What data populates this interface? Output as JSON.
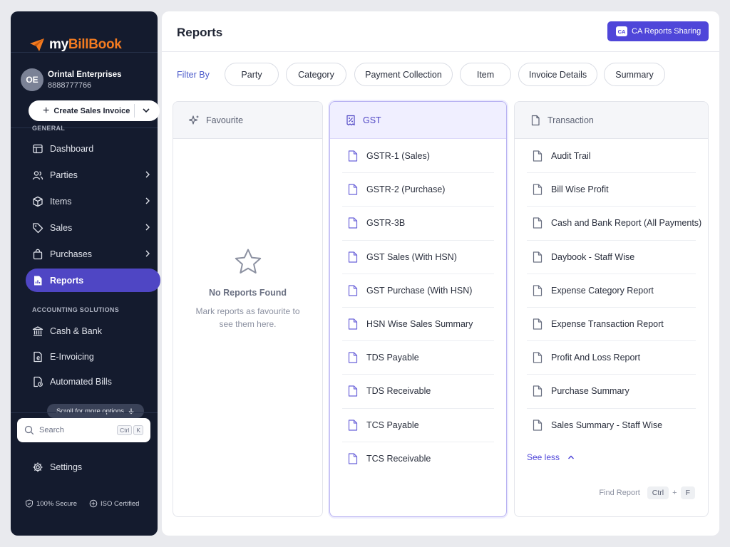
{
  "brand": {
    "logo_prefix": "my",
    "logo_suffix": "BillBook",
    "accent": "#f47b20"
  },
  "company": {
    "initials": "OE",
    "name": "Orintal Enterprises",
    "phone": "8888777766"
  },
  "create_button": {
    "label": "Create Sales Invoice"
  },
  "sidebar": {
    "general_label": "GENERAL",
    "general_items": [
      {
        "label": "Dashboard",
        "icon": "dashboard-icon"
      },
      {
        "label": "Parties",
        "icon": "users-icon"
      },
      {
        "label": "Items",
        "icon": "box-icon"
      },
      {
        "label": "Sales",
        "icon": "tag-icon"
      },
      {
        "label": "Purchases",
        "icon": "bag-icon"
      },
      {
        "label": "Reports",
        "icon": "reports-icon"
      }
    ],
    "accounting_label": "ACCOUNTING SOLUTIONS",
    "accounting_items": [
      {
        "label": "Cash & Bank",
        "icon": "bank-icon"
      },
      {
        "label": "E-Invoicing",
        "icon": "e-invoice-icon"
      },
      {
        "label": "Automated Bills",
        "icon": "automated-bills-icon"
      }
    ],
    "scroll_hint": "Scroll for more options",
    "search": {
      "placeholder": "Search",
      "shortcut_1": "Ctrl",
      "shortcut_2": "K"
    },
    "settings_label": "Settings",
    "badges": {
      "secure": "100% Secure",
      "iso": "ISO Certified"
    }
  },
  "header": {
    "title": "Reports",
    "ca_badge": "CA",
    "ca_button": "CA Reports Sharing"
  },
  "filters": {
    "label": "Filter By",
    "chips": [
      "Party",
      "Category",
      "Payment Collection",
      "Item",
      "Invoice Details",
      "Summary"
    ]
  },
  "columns": {
    "favourite": {
      "title": "Favourite",
      "empty_title": "No Reports Found",
      "empty_subtitle": "Mark reports as favourite to see them here."
    },
    "gst": {
      "title": "GST",
      "items": [
        "GSTR-1 (Sales)",
        "GSTR-2 (Purchase)",
        "GSTR-3B",
        "GST Sales (With HSN)",
        "GST Purchase (With HSN)",
        "HSN Wise Sales Summary",
        "TDS Payable",
        "TDS Receivable",
        "TCS Payable",
        "TCS Receivable"
      ]
    },
    "transaction": {
      "title": "Transaction",
      "items": [
        "Audit Trail",
        "Bill Wise Profit",
        "Cash and Bank Report (All Payments)",
        "Daybook - Staff Wise",
        "Expense Category Report",
        "Expense Transaction Report",
        "Profit And Loss Report",
        "Purchase Summary",
        "Sales Summary - Staff Wise"
      ],
      "see_less": "See less",
      "find_report": "Find Report",
      "find_key_1": "Ctrl",
      "find_plus": "+",
      "find_key_2": "F"
    }
  },
  "colors": {
    "primary": "#4f46d9",
    "sidebar_bg": "#141b2e",
    "active_nav": "#4f46c4"
  }
}
